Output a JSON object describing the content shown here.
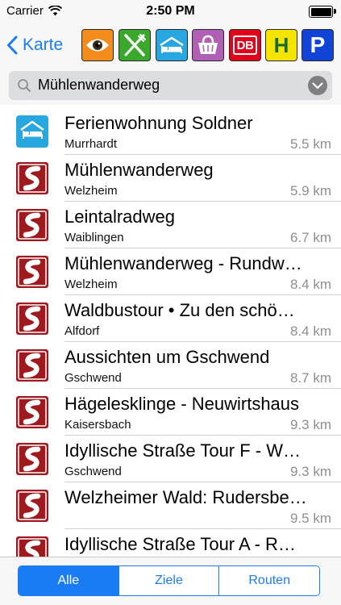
{
  "status_bar": {
    "carrier": "Carrier",
    "time": "2:50 PM",
    "battery_level": 1.0
  },
  "nav": {
    "back_label": "Karte",
    "categories": [
      {
        "name": "sights",
        "icon": "eye-icon",
        "bg": "#f28c1c"
      },
      {
        "name": "food",
        "icon": "fork-knife-icon",
        "bg": "#3aa82b"
      },
      {
        "name": "lodging",
        "icon": "bed-icon",
        "bg": "#27a6e0"
      },
      {
        "name": "shopping",
        "icon": "shopping-basket-icon",
        "bg": "#b15fb5"
      },
      {
        "name": "train",
        "icon": "db-logo",
        "bg": "#e3001b",
        "text": "DB"
      },
      {
        "name": "bus-stop",
        "icon": "h-stop-icon",
        "bg": "#f5e400",
        "text": "H"
      },
      {
        "name": "parking",
        "icon": "parking-icon",
        "bg": "#1043d6",
        "text": "P"
      }
    ]
  },
  "search": {
    "value": "Mühlenwanderweg"
  },
  "colors": {
    "accent": "#1a7cf5",
    "route_icon": "#9e1a1e",
    "lodging_icon": "#27a6e0"
  },
  "results": [
    {
      "title": "Ferienwohnung Soldner",
      "place": "Murrhardt",
      "distance": "5.5 km",
      "icon": "bed-icon"
    },
    {
      "title": "Mühlenwanderweg",
      "place": "Welzheim",
      "distance": "5.9 km",
      "icon": "route-icon"
    },
    {
      "title": "Leintalradweg",
      "place": "Waiblingen",
      "distance": "6.7 km",
      "icon": "route-icon"
    },
    {
      "title": "Mühlenwanderweg - Rundw…",
      "place": "Welzheim",
      "distance": "8.4 km",
      "icon": "route-icon"
    },
    {
      "title": "Waldbustour • Zu den schö…",
      "place": "Alfdorf",
      "distance": "8.4 km",
      "icon": "route-icon"
    },
    {
      "title": "Aussichten um Gschwend",
      "place": "Gschwend",
      "distance": "8.7 km",
      "icon": "route-icon"
    },
    {
      "title": "Hägelesklinge - Neuwirtshaus",
      "place": "Kaisersbach",
      "distance": "9.3 km",
      "icon": "route-icon"
    },
    {
      "title": "Idyllische Straße Tour F - W…",
      "place": "Gschwend",
      "distance": "9.3 km",
      "icon": "route-icon"
    },
    {
      "title": "Welzheimer Wald: Rudersbe…",
      "place": "",
      "distance": "9.5 km",
      "icon": "route-icon"
    },
    {
      "title": "Idyllische Straße Tour A - R…",
      "place": "",
      "distance": "",
      "icon": "route-icon"
    }
  ],
  "segments": [
    {
      "label": "Alle",
      "active": true
    },
    {
      "label": "Ziele",
      "active": false
    },
    {
      "label": "Routen",
      "active": false
    }
  ]
}
